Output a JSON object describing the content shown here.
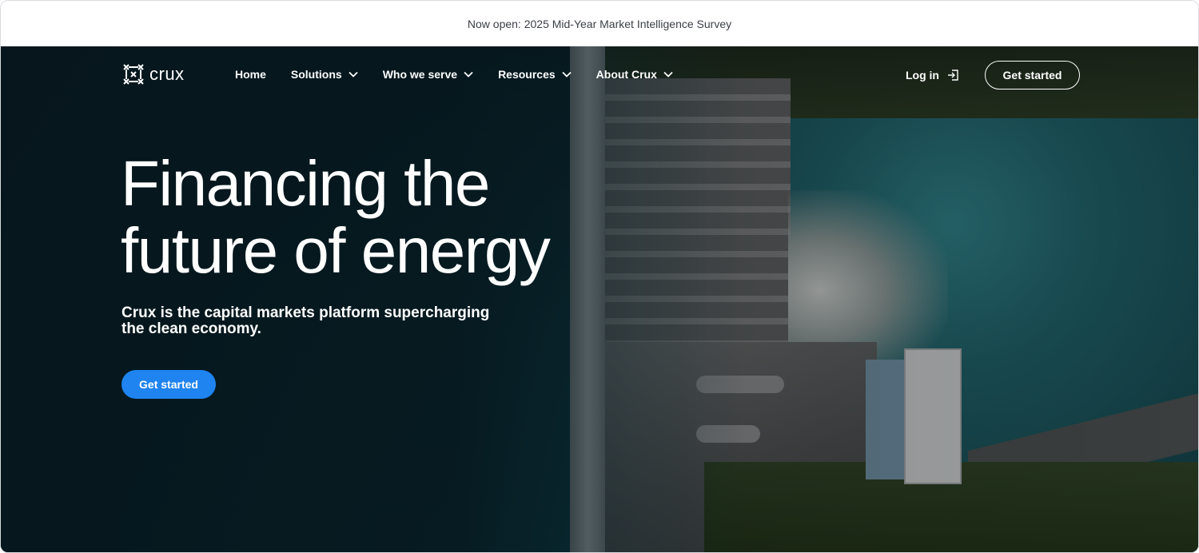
{
  "announcement": {
    "text": "Now open: 2025 Mid-Year Market Intelligence Survey"
  },
  "nav": {
    "logo_text": "crux",
    "logo_icon": "crux-logo-icon",
    "items": [
      {
        "label": "Home",
        "has_dropdown": false
      },
      {
        "label": "Solutions",
        "has_dropdown": true
      },
      {
        "label": "Who we serve",
        "has_dropdown": true
      },
      {
        "label": "Resources",
        "has_dropdown": true
      },
      {
        "label": "About Crux",
        "has_dropdown": true
      }
    ],
    "login_label": "Log in",
    "login_icon": "login-icon",
    "cta_label": "Get started"
  },
  "hero": {
    "headline_line1": "Financing the",
    "headline_line2": "future of energy",
    "subhead": "Crux is the capital markets platform supercharging the clean economy.",
    "cta_label": "Get started",
    "background_image": "aerial-dam-photo"
  },
  "colors": {
    "primary_button": "#1f84f0",
    "hero_dark": "#0b2830",
    "text_on_dark": "#ffffff",
    "announcement_text": "#3b3f45"
  }
}
